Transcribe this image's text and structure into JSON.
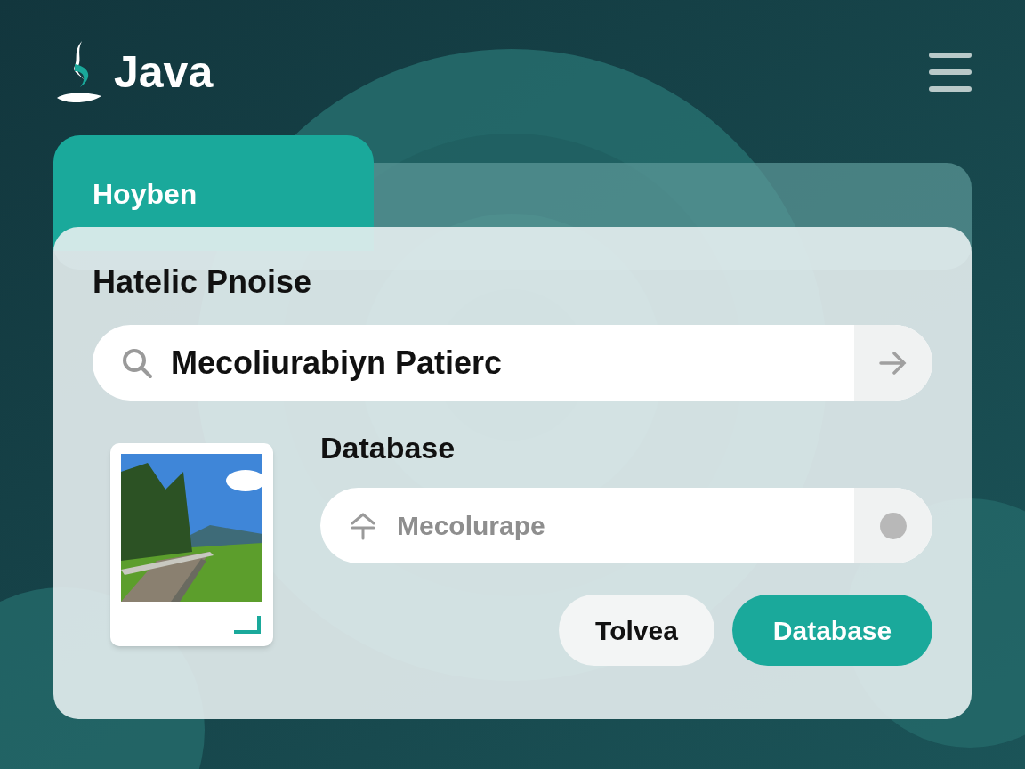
{
  "header": {
    "logo_text": "Java"
  },
  "tab": {
    "label": "Hoyben"
  },
  "card": {
    "title": "Hatelic Pnoise",
    "search": {
      "value": "Mecoliurabiyn Patierc"
    },
    "section_title": "Database",
    "filter_field": {
      "placeholder": "Mecolurape"
    },
    "buttons": [
      {
        "label": "Tolvea",
        "kind": "secondary"
      },
      {
        "label": "Database",
        "kind": "primary"
      }
    ]
  }
}
